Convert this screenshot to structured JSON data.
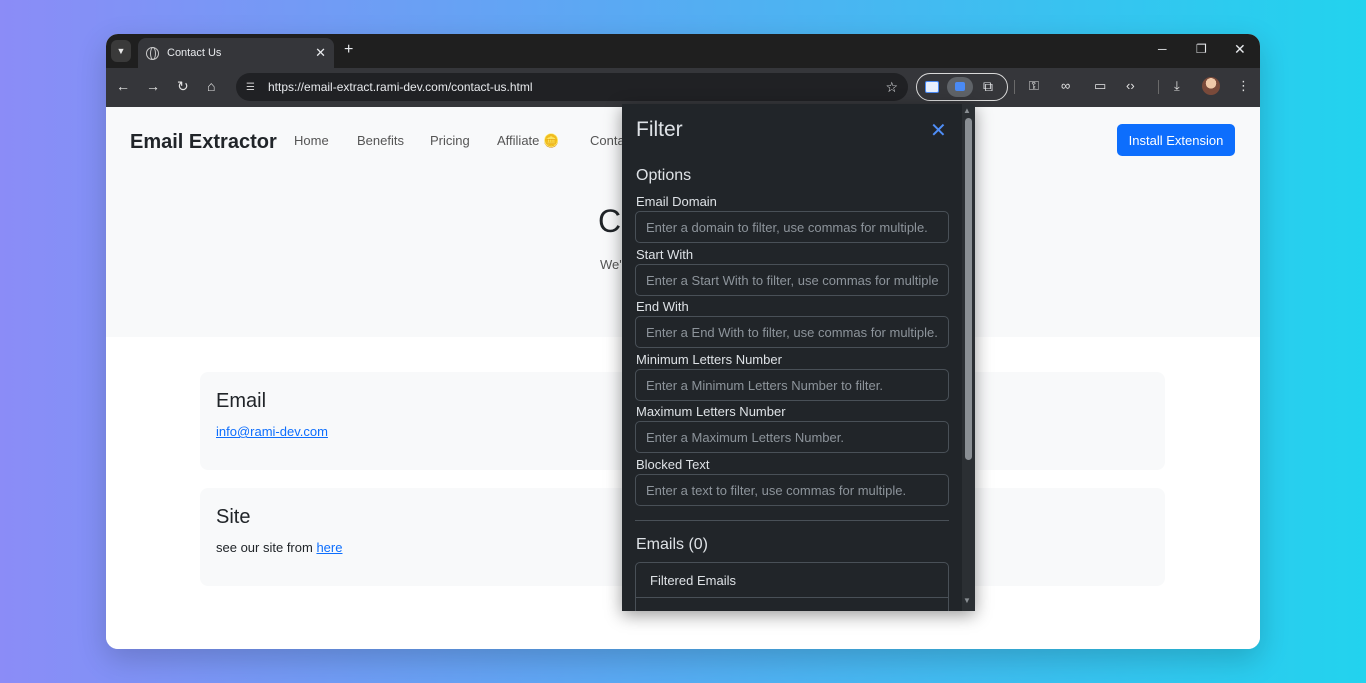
{
  "browser": {
    "tab_title": "Contact Us",
    "url": "https://email-extract.rami-dev.com/contact-us.html"
  },
  "site": {
    "brand": "Email Extractor",
    "nav": [
      "Home",
      "Benefits",
      "Pricing",
      "Affiliate 🪙",
      "Conta"
    ],
    "install_button": "Install Extension",
    "hero_title": "C",
    "hero_sub": "We'",
    "cards": {
      "email_title": "Email",
      "email_link": "info@rami-dev.com",
      "site_title": "Site",
      "site_text": "see our site from ",
      "site_link": "here"
    }
  },
  "popup": {
    "title": "Filter",
    "close": "✕",
    "options_title": "Options",
    "fields": [
      {
        "label": "Email Domain",
        "placeholder": "Enter a domain to filter, use commas for multiple."
      },
      {
        "label": "Start With",
        "placeholder": "Enter a Start With to filter, use commas for multiple."
      },
      {
        "label": "End With",
        "placeholder": "Enter a End With to filter, use commas for multiple."
      },
      {
        "label": "Minimum Letters Number",
        "placeholder": "Enter a Minimum Letters Number to filter."
      },
      {
        "label": "Maximum Letters Number",
        "placeholder": "Enter a Maximum Letters Number."
      },
      {
        "label": "Blocked Text",
        "placeholder": "Enter a text to filter, use commas for multiple."
      }
    ],
    "emails_title": "Emails (0)",
    "list_items": [
      "Filtered Emails"
    ]
  },
  "icons": [
    "tab-search-icon",
    "globe-icon",
    "close-icon",
    "plus-icon",
    "minimize-icon",
    "restore-icon",
    "back-icon",
    "forward-icon",
    "reload-icon",
    "home-icon",
    "tune-icon",
    "star-icon",
    "puzzle-icon",
    "key-icon",
    "link-icon",
    "devices-icon",
    "code-icon",
    "download-icon",
    "menu-icon"
  ]
}
